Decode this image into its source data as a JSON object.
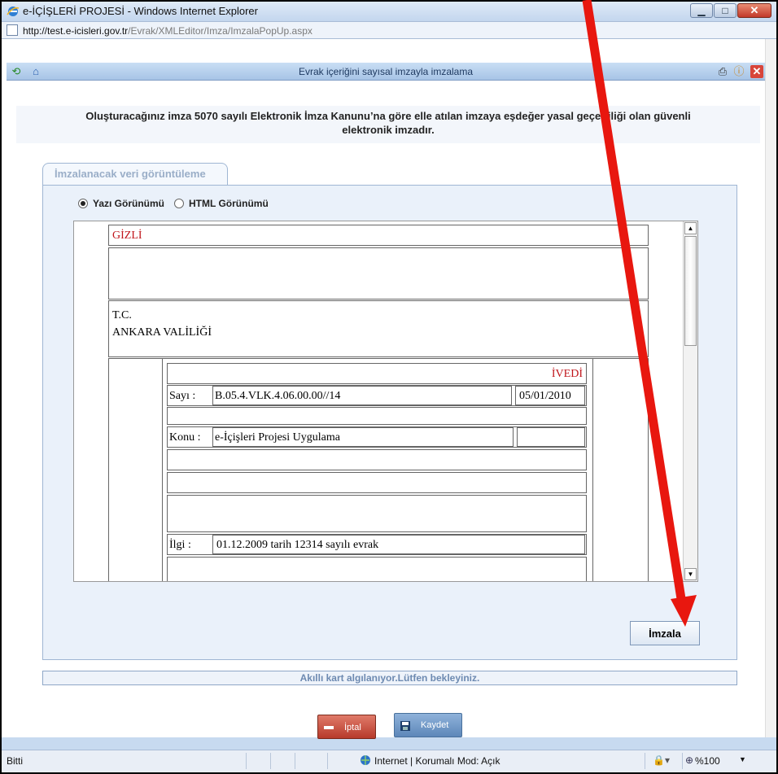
{
  "window": {
    "title": "e-İÇİŞLERİ PROJESİ - Windows Internet Explorer",
    "url_host": "http://test.e-icisleri.gov.tr",
    "url_path": "/Evrak/XMLEditor/Imza/ImzalaPopUp.aspx"
  },
  "popup": {
    "title": "Evrak içeriğini sayısal imzayla imzalama",
    "notice_line1": "Oluşturacağınız imza 5070 sayılı Elektronik İmza Kanunu’na göre elle atılan imzaya eşdeğer yasal geçerliliği olan güvenli",
    "notice_line2": "elektronik imzadır.",
    "tab_label": "İmzalanacak veri görüntüleme",
    "radio_text": "Yazı Görünümü",
    "radio_html": "HTML Görünümü",
    "sign_button": "İmzala",
    "card_status": "Akıllı kart algılanıyor.Lütfen bekleyiniz.",
    "cancel_button": "İptal",
    "save_button": "Kaydet"
  },
  "document": {
    "classification": "GİZLİ",
    "header_line1": "T.C.",
    "header_line2": "ANKARA VALİLİĞİ",
    "urgency": "İVEDİ",
    "sayi_label": "Sayı   :",
    "sayi_value": "B.05.4.VLK.4.06.00.00//14",
    "date": "05/01/2010",
    "konu_label": "Konu :",
    "konu_value": "e-İçişleri Projesi Uygulama",
    "ilgi_label": "İlgi :",
    "ilgi_value": "01.12.2009 tarih 12314 sayılı evrak"
  },
  "statusbar": {
    "left": "Bitti",
    "zone": "Internet | Korumalı Mod: Açık",
    "zoom": "%100"
  },
  "colors": {
    "annotation_arrow": "#e8170f",
    "classification_text": "#c0151b"
  }
}
